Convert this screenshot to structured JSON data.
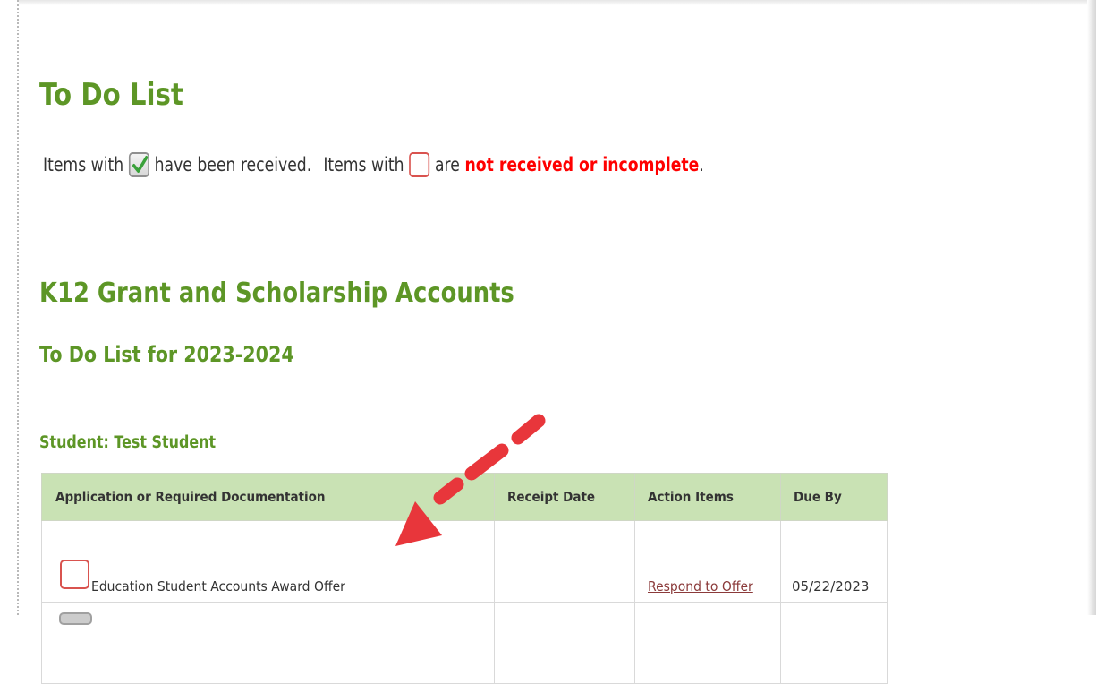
{
  "page": {
    "title": "To Do List"
  },
  "legend": {
    "part1": "Items with",
    "part2": "have been received.",
    "part3": "Items with",
    "part4": "are",
    "emphasis": "not received or incomplete",
    "end": ".",
    "received_icon": "checkbox-checked-icon",
    "incomplete_icon": "checkbox-empty-icon"
  },
  "section": {
    "title": "K12 Grant and Scholarship Accounts",
    "subtitle": "To Do List for 2023-2024",
    "student_label": "Student: Test Student"
  },
  "table": {
    "headers": [
      "Application or Required Documentation",
      "Receipt Date",
      "Action Items",
      "Due By"
    ],
    "rows": [
      {
        "document": "Education Student Accounts Award Offer",
        "receipt_date": "",
        "action": "Respond to Offer",
        "due_by": "05/22/2023",
        "status_icon": "checkbox-empty-icon"
      }
    ]
  },
  "colors": {
    "heading_green": "#5d9626",
    "header_bg": "#c9e2b4",
    "alert_red": "#ff0000",
    "arrow_red": "#e8363b",
    "link": "#8b3a3a"
  }
}
